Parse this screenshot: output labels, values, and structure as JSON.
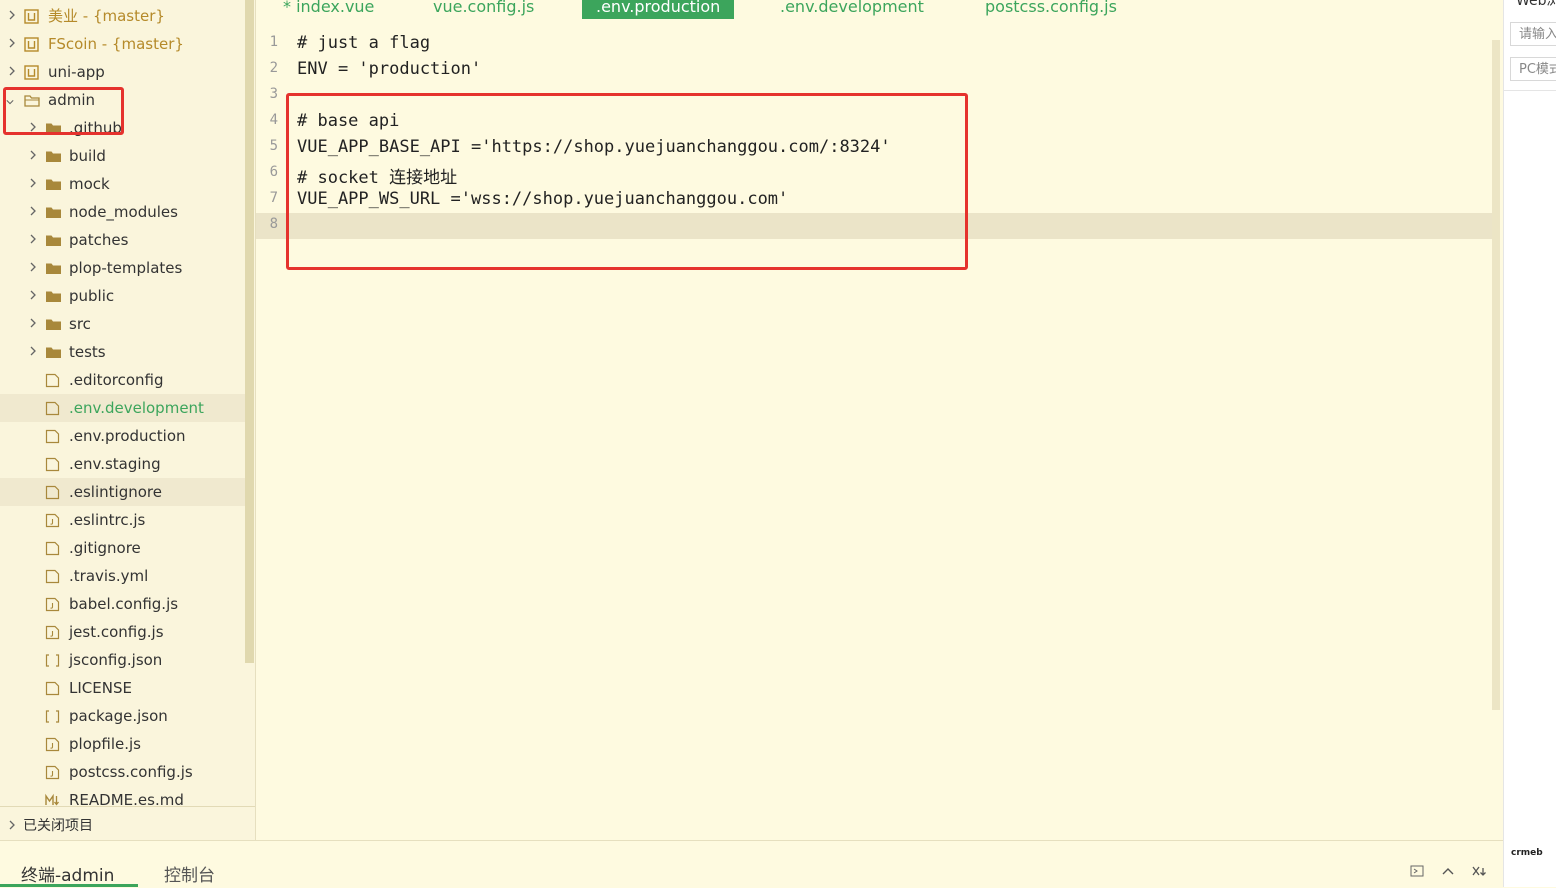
{
  "sidebar": {
    "items": [
      {
        "label": "美业 - {master}",
        "type": "project",
        "level": 0,
        "expanded": false,
        "icon": "project-icon"
      },
      {
        "label": "FScoin - {master}",
        "type": "project",
        "level": 0,
        "expanded": false,
        "icon": "project-icon"
      },
      {
        "label": "uni-app",
        "type": "folder-root",
        "level": 0,
        "expanded": false,
        "icon": "project-icon"
      },
      {
        "label": "admin",
        "type": "folder-root",
        "level": 0,
        "expanded": true,
        "icon": "folder-open-icon"
      },
      {
        "label": ".github",
        "type": "folder",
        "level": 1,
        "expanded": false,
        "icon": "folder-icon"
      },
      {
        "label": "build",
        "type": "folder",
        "level": 1,
        "expanded": false,
        "icon": "folder-icon"
      },
      {
        "label": "mock",
        "type": "folder",
        "level": 1,
        "expanded": false,
        "icon": "folder-icon"
      },
      {
        "label": "node_modules",
        "type": "folder",
        "level": 1,
        "expanded": false,
        "icon": "folder-icon"
      },
      {
        "label": "patches",
        "type": "folder",
        "level": 1,
        "expanded": false,
        "icon": "folder-icon"
      },
      {
        "label": "plop-templates",
        "type": "folder",
        "level": 1,
        "expanded": false,
        "icon": "folder-icon"
      },
      {
        "label": "public",
        "type": "folder",
        "level": 1,
        "expanded": false,
        "icon": "folder-icon"
      },
      {
        "label": "src",
        "type": "folder",
        "level": 1,
        "expanded": false,
        "icon": "folder-icon"
      },
      {
        "label": "tests",
        "type": "folder",
        "level": 1,
        "expanded": false,
        "icon": "folder-icon"
      },
      {
        "label": ".editorconfig",
        "type": "file",
        "level": 1,
        "icon": "file-icon"
      },
      {
        "label": ".env.development",
        "type": "file",
        "level": 1,
        "icon": "file-icon",
        "active": true
      },
      {
        "label": ".env.production",
        "type": "file",
        "level": 1,
        "icon": "file-icon"
      },
      {
        "label": ".env.staging",
        "type": "file",
        "level": 1,
        "icon": "file-icon"
      },
      {
        "label": ".eslintignore",
        "type": "file",
        "level": 1,
        "icon": "file-icon",
        "hover": true
      },
      {
        "label": ".eslintrc.js",
        "type": "file",
        "level": 1,
        "icon": "js-file-icon"
      },
      {
        "label": ".gitignore",
        "type": "file",
        "level": 1,
        "icon": "file-icon"
      },
      {
        "label": ".travis.yml",
        "type": "file",
        "level": 1,
        "icon": "file-icon"
      },
      {
        "label": "babel.config.js",
        "type": "file",
        "level": 1,
        "icon": "js-file-icon"
      },
      {
        "label": "jest.config.js",
        "type": "file",
        "level": 1,
        "icon": "js-file-icon"
      },
      {
        "label": "jsconfig.json",
        "type": "file",
        "level": 1,
        "icon": "json-file-icon"
      },
      {
        "label": "LICENSE",
        "type": "file",
        "level": 1,
        "icon": "file-icon"
      },
      {
        "label": "package.json",
        "type": "file",
        "level": 1,
        "icon": "json-file-icon"
      },
      {
        "label": "plopfile.js",
        "type": "file",
        "level": 1,
        "icon": "js-file-icon"
      },
      {
        "label": "postcss.config.js",
        "type": "file",
        "level": 1,
        "icon": "js-file-icon"
      },
      {
        "label": "README.es.md",
        "type": "file",
        "level": 1,
        "icon": "markdown-file-icon"
      }
    ],
    "closed_projects_label": "已关闭项目"
  },
  "tabs": [
    {
      "label": "* index.vue",
      "active": false
    },
    {
      "label": "vue.config.js",
      "active": false
    },
    {
      "label": ".env.production",
      "active": true
    },
    {
      "label": ".env.development",
      "active": false
    },
    {
      "label": "postcss.config.js",
      "active": false
    }
  ],
  "editor": {
    "lines": [
      {
        "n": "1",
        "text": "# just a flag"
      },
      {
        "n": "2",
        "text": "ENV = 'production'"
      },
      {
        "n": "3",
        "text": ""
      },
      {
        "n": "4",
        "text": "# base api"
      },
      {
        "n": "5",
        "text": "VUE_APP_BASE_API ='https://shop.yuejuanchanggou.com/:8324'"
      },
      {
        "n": "6",
        "text": "# socket 连接地址"
      },
      {
        "n": "7",
        "text": "VUE_APP_WS_URL ='wss://shop.yuejuanchanggou.com'"
      },
      {
        "n": "8",
        "text": "",
        "current": true
      }
    ]
  },
  "right_panel": {
    "title": "Web浏",
    "input1_placeholder": "请输入",
    "input2_value": "PC模式",
    "logo": "crmeb"
  },
  "bottom": {
    "tabs": [
      {
        "label": "终端-admin",
        "active": true
      },
      {
        "label": "控制台",
        "active": false
      }
    ]
  },
  "colors": {
    "accent": "#3ca55c",
    "background": "#fefae0",
    "annotation": "#e5322d",
    "project_label": "#b58a2a"
  }
}
